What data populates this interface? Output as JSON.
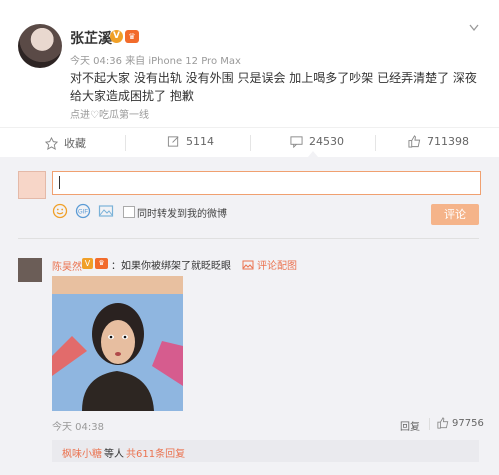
{
  "post": {
    "user_name": "张芷溪",
    "v_badge": "V",
    "time": "今天 04:36",
    "source": "来自 iPhone 12 Pro Max",
    "text": "对不起大家 没有出轨 没有外围 只是误会 加上喝多了吵架 已经弄清楚了 深夜给大家造成困扰了 抱歉",
    "source_link": "点进♡吃瓜第一线"
  },
  "actions": {
    "favorite": "收藏",
    "repost": "5114",
    "comment": "24530",
    "like": "711398"
  },
  "composer": {
    "input_value": "",
    "checkbox_label": "同时转发到我的微博",
    "submit": "评论"
  },
  "comment": {
    "user": "陈昊然",
    "v_badge": "V",
    "text": "：如果你被绑架了就眨眨眼",
    "image_link": "评论配图",
    "time": "今天 04:38",
    "reply": "回复",
    "likes": "97756",
    "more_user": "枫味小糖",
    "more_mid": "等人",
    "more_link": "共611条回复"
  },
  "colors": {
    "accent": "#eb7350",
    "button": "#f5b48a",
    "v_badge": "#f0a028"
  }
}
